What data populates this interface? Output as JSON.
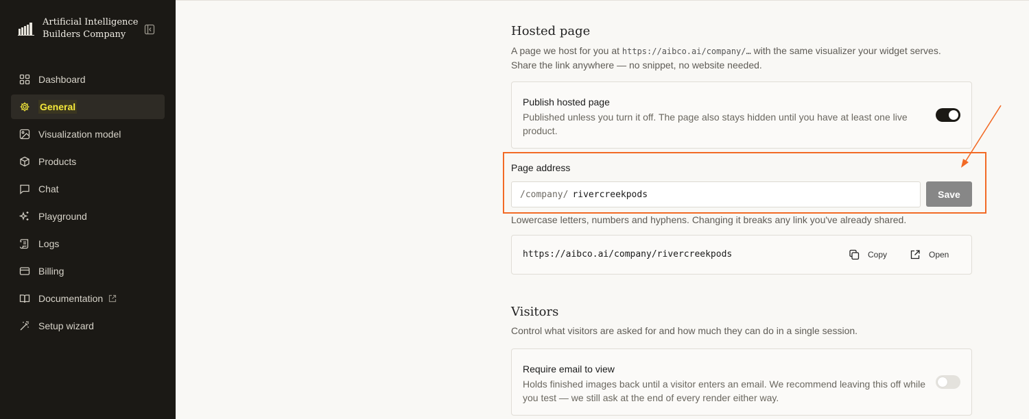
{
  "brand": {
    "name_line1": "Artificial Intelligence",
    "name_line2": "Builders Company"
  },
  "sidebar": {
    "items": [
      {
        "label": "Dashboard",
        "icon": "grid-icon"
      },
      {
        "label": "General",
        "icon": "gear-icon",
        "active": true
      },
      {
        "label": "Visualization model",
        "icon": "image-icon"
      },
      {
        "label": "Products",
        "icon": "box-icon"
      },
      {
        "label": "Chat",
        "icon": "chat-icon"
      },
      {
        "label": "Playground",
        "icon": "sparkles-icon"
      },
      {
        "label": "Logs",
        "icon": "scroll-icon"
      },
      {
        "label": "Billing",
        "icon": "credit-card-icon"
      },
      {
        "label": "Documentation",
        "icon": "book-icon",
        "external": true
      },
      {
        "label": "Setup wizard",
        "icon": "wand-icon"
      }
    ]
  },
  "hosted": {
    "title": "Hosted page",
    "desc_prefix": "A page we host for you at ",
    "desc_url": "https://aibco.ai/company/…",
    "desc_suffix": " with the same visualizer your widget serves.",
    "desc_line2": "Share the link anywhere — no snippet, no website needed.",
    "publish_title": "Publish hosted page",
    "publish_desc": "Published unless you turn it off. The page also stays hidden until you have at least one live product.",
    "publish_on": true,
    "address_label": "Page address",
    "address_prefix": "/company/",
    "address_value": "rivercreekpods",
    "save_label": "Save",
    "address_hint": "Lowercase letters, numbers and hyphens. Changing it breaks any link you've already shared.",
    "full_url": "https://aibco.ai/company/rivercreekpods",
    "copy_label": "Copy",
    "open_label": "Open"
  },
  "visitors": {
    "title": "Visitors",
    "desc": "Control what visitors are asked for and how much they can do in a single session.",
    "email_title": "Require email to view",
    "email_desc": "Holds finished images back until a visitor enters an email. We recommend leaving this off while you test — we still ask at the end of every render either way.",
    "email_on": false
  },
  "colors": {
    "sidebar_bg": "#1b1915",
    "accent_yellow": "#f5e93a",
    "annotation": "#f26a25",
    "save_disabled": "#878787"
  }
}
